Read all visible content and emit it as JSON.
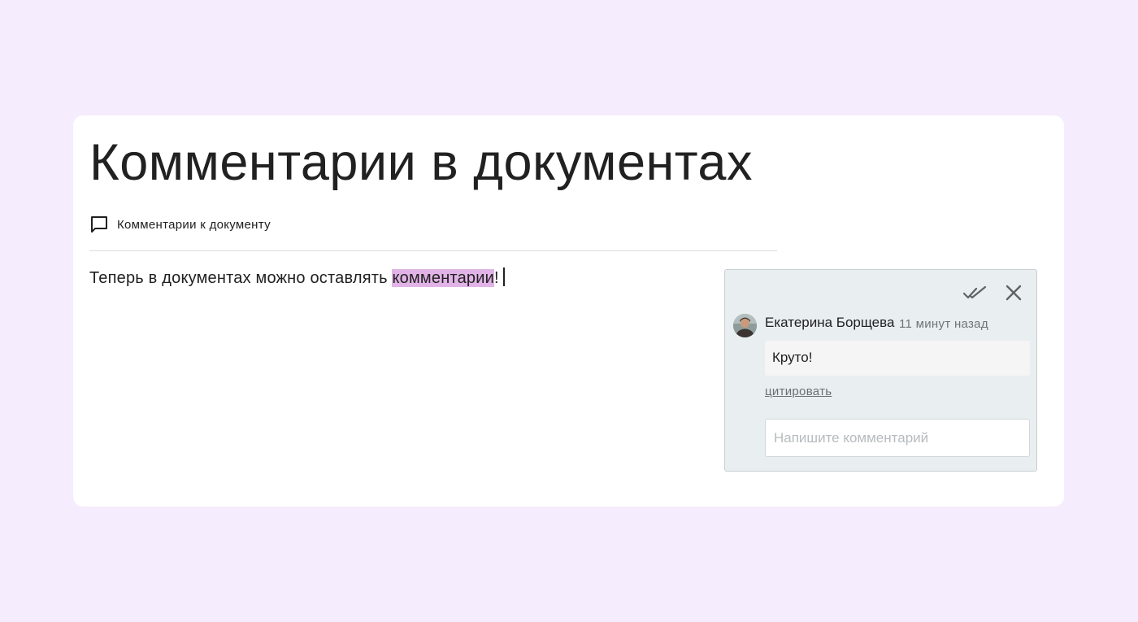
{
  "document": {
    "title": "Комментарии в документах",
    "comments_link_label": "Комментарии к документу",
    "body_text_before": "Теперь в документах можно оставлять ",
    "body_text_highlighted": "комментарии",
    "body_text_after": "!"
  },
  "comment_panel": {
    "resolve_icon": "double-check-icon",
    "close_icon": "close-icon",
    "comment": {
      "author": "Екатерина Борщева",
      "time": "11 минут назад",
      "text": "Круто!",
      "quote_label": "цитировать"
    },
    "reply_input": {
      "value": "",
      "placeholder": "Напишите комментарий"
    }
  },
  "colors": {
    "page_background": "#f5ecfd",
    "highlight": "#e1b3e6",
    "panel_background": "#e9eef0"
  }
}
